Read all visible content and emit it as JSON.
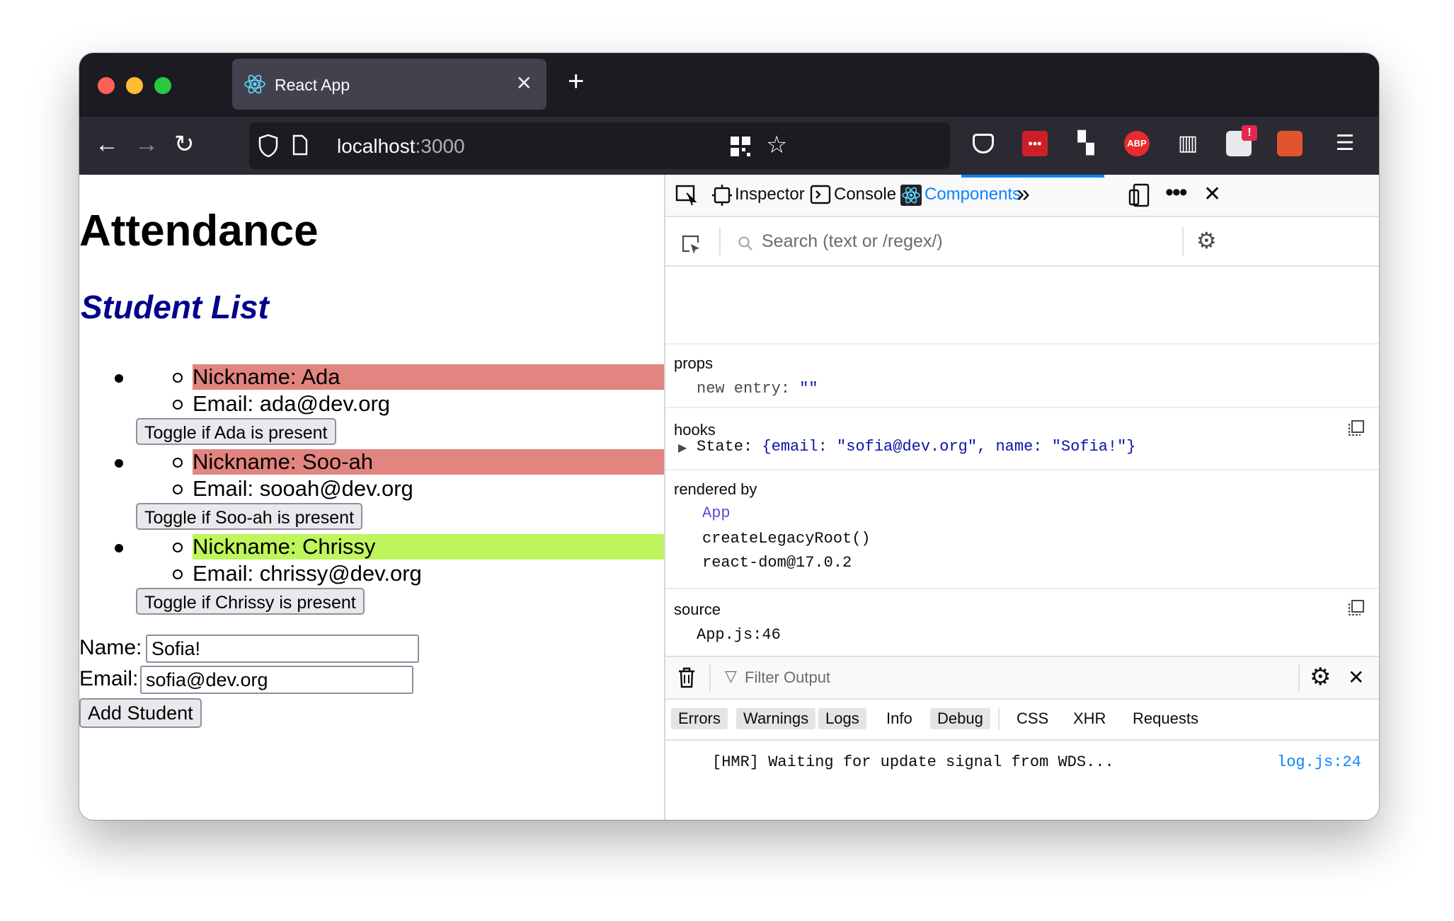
{
  "browser": {
    "tab_title": "React App",
    "url_host": "localhost",
    "url_port": ":3000"
  },
  "page": {
    "heading": "Attendance",
    "subheading": "Student List",
    "students": [
      {
        "nickname": "Nickname: Ada",
        "email": "Email: ada@dev.org",
        "toggle": "Toggle if Ada is present",
        "color": "#e2847f"
      },
      {
        "nickname": "Nickname: Soo-ah",
        "email": "Email: sooah@dev.org",
        "toggle": "Toggle if Soo-ah is present",
        "color": "#e2847f"
      },
      {
        "nickname": "Nickname: Chrissy",
        "email": "Email: chrissy@dev.org",
        "toggle": "Toggle if Chrissy is present",
        "color": "#bff55d"
      }
    ],
    "form": {
      "name_label": "Name:",
      "name_value": "Sofia!",
      "email_label": "Email:",
      "email_value": "sofia@dev.org",
      "submit_label": "Add Student"
    }
  },
  "devtools": {
    "tabs": {
      "inspector": "Inspector",
      "console": "Console",
      "components": "Components"
    },
    "search_placeholder": "Search (text or /regex/)",
    "props": {
      "title": "props",
      "key": "new entry",
      "value": "\"\""
    },
    "hooks": {
      "title": "hooks",
      "label": "State:",
      "value": "{email: \"sofia@dev.org\", name: \"Sofia!\"}"
    },
    "rendered_by": {
      "title": "rendered by",
      "items": [
        "App",
        "createLegacyRoot()",
        "react-dom@17.0.2"
      ]
    },
    "source": {
      "title": "source",
      "value": "App.js:46"
    },
    "console": {
      "filter_placeholder": "Filter Output",
      "filters": [
        "Errors",
        "Warnings",
        "Logs",
        "Info",
        "Debug",
        "CSS",
        "XHR",
        "Requests"
      ],
      "message": "[HMR] Waiting for update signal from WDS...",
      "message_source": "log.js:24"
    }
  },
  "colors": {
    "link_blue": "#0a84ff",
    "heading_navy": "#00008b"
  }
}
